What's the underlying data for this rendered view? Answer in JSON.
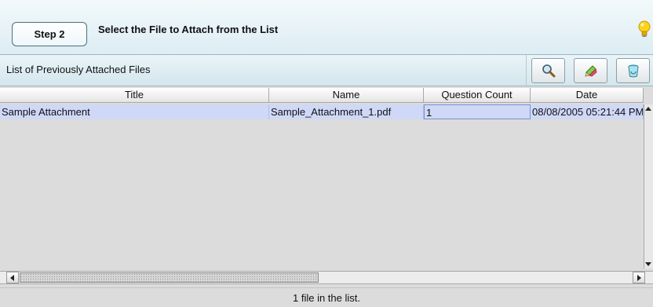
{
  "step": {
    "badge_label": "Step 2",
    "title": "Select the File to Attach from the List",
    "tip_icon": "lightbulb-icon"
  },
  "list": {
    "title": "List of Previously Attached Files",
    "toolbar": [
      {
        "icon": "magnifier-icon"
      },
      {
        "icon": "pencil-icon"
      },
      {
        "icon": "trash-icon"
      }
    ]
  },
  "table": {
    "columns": [
      "Title",
      "Name",
      "Question Count",
      "Date"
    ],
    "rows": [
      [
        "Sample Attachment",
        "Sample_Attachment_1.pdf",
        "1",
        "08/08/2005 05:21:44 PM"
      ]
    ]
  },
  "status": {
    "text": "1 file in the list."
  },
  "colors": {
    "header_bg": "#dcedf3",
    "selected_row": "#cfd9f7",
    "panel_bg": "#dcdcdc"
  }
}
